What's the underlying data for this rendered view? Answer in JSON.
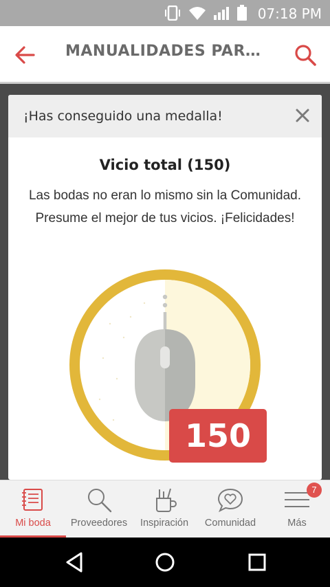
{
  "status_bar": {
    "time": "07:18 PM",
    "icons": [
      "vibrate-icon",
      "wifi-icon",
      "signal-icon",
      "battery-icon"
    ]
  },
  "app_bar": {
    "title": "MANUALIDADES PARA...",
    "back_icon": "arrow-left-icon",
    "search_icon": "search-icon",
    "accent": "#d94a48"
  },
  "modal": {
    "header_title": "¡Has conseguido una medalla!",
    "close_icon": "close-icon",
    "medal_name": "Vicio total (150)",
    "description": "Las bodas no eran lo mismo sin la Comunidad. Presume el mejor de tus vicios. ¡Felicidades!",
    "badge_value": "150",
    "medal_icon": "computer-mouse-icon",
    "colors": {
      "ring": "#e2b73a",
      "badge": "#d94a48"
    }
  },
  "bottom_nav": {
    "items": [
      {
        "label": "Mi boda",
        "icon": "notebook-icon",
        "active": true
      },
      {
        "label": "Proveedores",
        "icon": "search-icon",
        "active": false
      },
      {
        "label": "Inspiración",
        "icon": "pencil-cup-icon",
        "active": false
      },
      {
        "label": "Comunidad",
        "icon": "heart-chat-icon",
        "active": false
      },
      {
        "label": "Más",
        "icon": "menu-icon",
        "active": false,
        "badge": "7"
      }
    ]
  },
  "system_nav": {
    "buttons": [
      "back-triangle-icon",
      "home-circle-icon",
      "recents-square-icon"
    ]
  }
}
